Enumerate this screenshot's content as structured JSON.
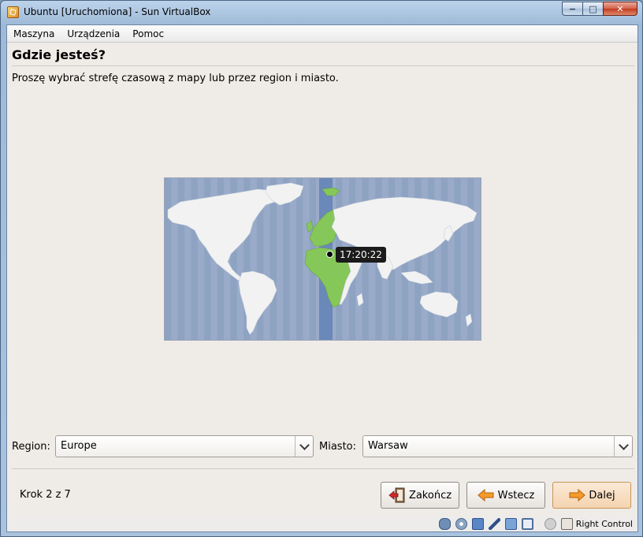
{
  "window": {
    "title": "Ubuntu [Uruchomiona] - Sun VirtualBox",
    "buttons": {
      "minimize": "−",
      "maximize": "□",
      "close": "✕"
    }
  },
  "menubar": {
    "items": [
      "Maszyna",
      "Urządzenia",
      "Pomoc"
    ]
  },
  "page": {
    "heading": "Gdzie jesteś?",
    "instruction": "Proszę wybrać strefę czasową z mapy lub przez region i miasto."
  },
  "map": {
    "time": "17:20:22"
  },
  "region": {
    "label": "Region:",
    "value": "Europe"
  },
  "city": {
    "label": "Miasto:",
    "value": "Warsaw"
  },
  "footer": {
    "step": "Krok 2 z 7",
    "quit_label": "Zakończ",
    "back_label": "Wstecz",
    "next_label": "Dalej"
  },
  "statusbar": {
    "host_key": "Right Control",
    "icons": [
      "hard-disk-icon",
      "optical-disk-icon",
      "network-icon",
      "usb-icon",
      "shared-folder-icon",
      "display-icon",
      "mouse-integration-icon",
      "host-key-icon"
    ]
  },
  "colors": {
    "map_water": "#95a8c6",
    "land": "#f2f2f2",
    "selected_zone": "#86c759",
    "zone_band": "#6a88b8"
  }
}
